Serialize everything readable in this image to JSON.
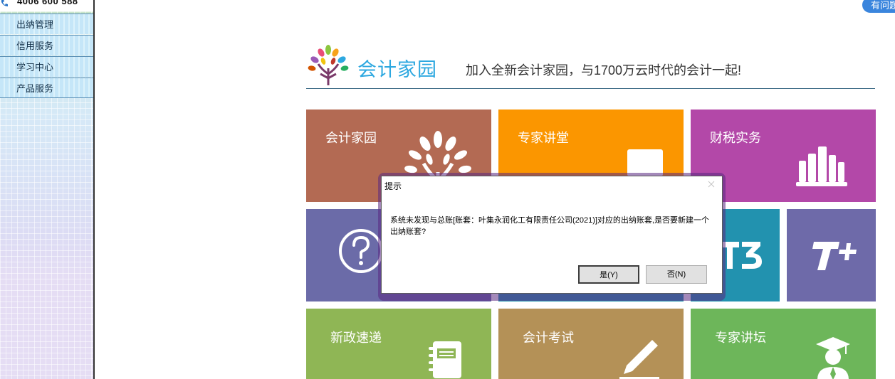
{
  "sidebar": {
    "phone": "4006 600 588",
    "items": [
      {
        "label": "出纳管理"
      },
      {
        "label": "信用服务"
      },
      {
        "label": "学习中心"
      },
      {
        "label": "产品服务"
      }
    ]
  },
  "help_button": {
    "label": "有问题"
  },
  "header": {
    "logo_text": "会计家园",
    "slogan": "加入全新会计家园，与1700万云时代的会计一起!"
  },
  "tiles": [
    {
      "label": "会计家园",
      "color": "#b36a53",
      "icon": "tree-icon"
    },
    {
      "label": "专家讲堂",
      "color": "#fb9600",
      "icon": "screen-icon"
    },
    {
      "label": "财税实务",
      "color": "#b348a8",
      "icon": "books-icon"
    },
    {
      "label": "",
      "color": "#6b6ba8",
      "icon": "question-icon"
    },
    {
      "label": "",
      "color": "#2795b0",
      "icon": "t3-icon"
    },
    {
      "label": "",
      "color": "#2292af",
      "icon": "t3-icon"
    },
    {
      "label": "",
      "color": "#6e6aa9",
      "icon": "tplus-icon"
    },
    {
      "label": "新政速递",
      "color": "#8fb655",
      "icon": "notebook-icon"
    },
    {
      "label": "会计考试",
      "color": "#b49157",
      "icon": "pen-icon"
    },
    {
      "label": "专家讲坛",
      "color": "#6db65a",
      "icon": "scholar-icon"
    }
  ],
  "dialog": {
    "title": "提示",
    "message": "系统未发现与总账[账套：叶集永润化工有限责任公司(2021)]对应的出纳账套,是否要新建一个出纳账套?",
    "yes_label": "是(Y)",
    "no_label": "否(N)"
  },
  "icons": {
    "phone": "phone-icon",
    "close": "close-icon",
    "logo": "tree-logo-icon"
  }
}
